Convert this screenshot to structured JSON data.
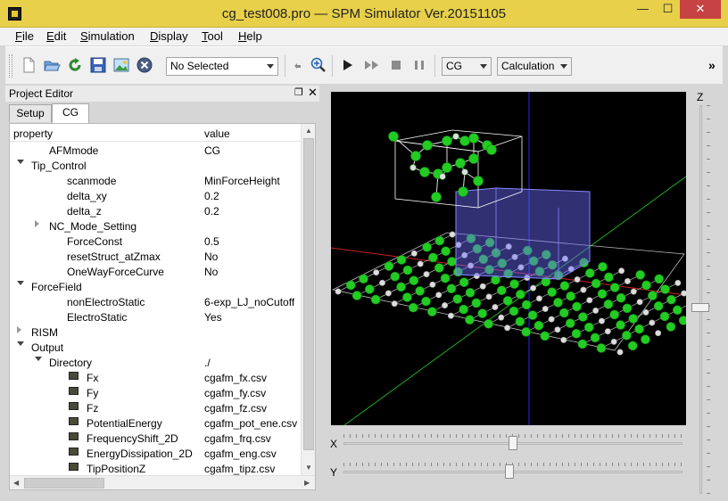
{
  "window": {
    "title": "cg_test008.pro — SPM Simulator Ver.20151105",
    "minimize": "—",
    "maximize": "☐",
    "close": "✕"
  },
  "menu": [
    {
      "label": "File",
      "key": "F",
      "rest": "ile"
    },
    {
      "label": "Edit",
      "key": "E",
      "rest": "dit"
    },
    {
      "label": "Simulation",
      "key": "S",
      "rest": "imulation"
    },
    {
      "label": "Display",
      "key": "D",
      "rest": "isplay"
    },
    {
      "label": "Tool",
      "key": "T",
      "rest": "ool"
    },
    {
      "label": "Help",
      "key": "H",
      "rest": "elp"
    }
  ],
  "toolbar": {
    "selection_combo": "No Selected",
    "mode_combo": "CG",
    "action_combo": "Calculation",
    "overflow": "»",
    "accent": "#2e8b2e"
  },
  "panel": {
    "title": "Project Editor",
    "float_icon": "❐",
    "close_icon": "✕",
    "tabs": [
      "Setup",
      "CG"
    ],
    "active_tab": "CG",
    "columns": {
      "property": "property",
      "value": "value"
    }
  },
  "tree": [
    {
      "name": "AFMmode",
      "value": "CG",
      "level": 1,
      "expander": "none"
    },
    {
      "name": "Tip_Control",
      "value": "",
      "level": 0,
      "expander": "down"
    },
    {
      "name": "scanmode",
      "value": "MinForceHeight",
      "level": 2,
      "expander": "none"
    },
    {
      "name": "delta_xy",
      "value": "0.2",
      "level": 2,
      "expander": "none"
    },
    {
      "name": "delta_z",
      "value": "0.2",
      "level": 2,
      "expander": "none"
    },
    {
      "name": "NC_Mode_Setting",
      "value": "",
      "level": 1,
      "expander": "right"
    },
    {
      "name": "ForceConst",
      "value": "0.5",
      "level": 2,
      "expander": "none"
    },
    {
      "name": "resetStruct_atZmax",
      "value": "No",
      "level": 2,
      "expander": "none"
    },
    {
      "name": "OneWayForceCurve",
      "value": "No",
      "level": 2,
      "expander": "none"
    },
    {
      "name": "ForceField",
      "value": "",
      "level": 0,
      "expander": "down"
    },
    {
      "name": "nonElectroStatic",
      "value": "6-exp_LJ_noCutoff",
      "level": 2,
      "expander": "none"
    },
    {
      "name": "ElectroStatic",
      "value": "Yes",
      "level": 2,
      "expander": "none"
    },
    {
      "name": "RISM",
      "value": "",
      "level": 0,
      "expander": "right"
    },
    {
      "name": "Output",
      "value": "",
      "level": 0,
      "expander": "down"
    },
    {
      "name": "Directory",
      "value": "./",
      "level": 1,
      "expander": "down"
    },
    {
      "name": "Fx",
      "value": "cgafm_fx.csv",
      "level": 3,
      "expander": "file"
    },
    {
      "name": "Fy",
      "value": "cgafm_fy.csv",
      "level": 3,
      "expander": "file"
    },
    {
      "name": "Fz",
      "value": "cgafm_fz.csv",
      "level": 3,
      "expander": "file"
    },
    {
      "name": "PotentialEnergy",
      "value": "cgafm_pot_ene.csv",
      "level": 3,
      "expander": "file"
    },
    {
      "name": "FrequencyShift_2D",
      "value": "cgafm_frq.csv",
      "level": 3,
      "expander": "file"
    },
    {
      "name": "EnergyDissipation_2D",
      "value": "cgafm_eng.csv",
      "level": 3,
      "expander": "file"
    },
    {
      "name": "TipPositionZ",
      "value": "cgafm_tipz.csv",
      "level": 3,
      "expander": "file"
    }
  ],
  "viewer": {
    "background": "#000000",
    "atom_color": "#22cc22",
    "hydrogen_color": "#dddddd",
    "box_color": "#6a6aff",
    "axis_x_color": "#cc2222",
    "axis_y_color": "#22aa22",
    "axis_z_color": "#2222cc"
  },
  "sliders": {
    "x_label": "X",
    "y_label": "Y",
    "z_label": "Z",
    "x_level": 0.5,
    "y_level": 0.49,
    "z_level": 0.52
  }
}
